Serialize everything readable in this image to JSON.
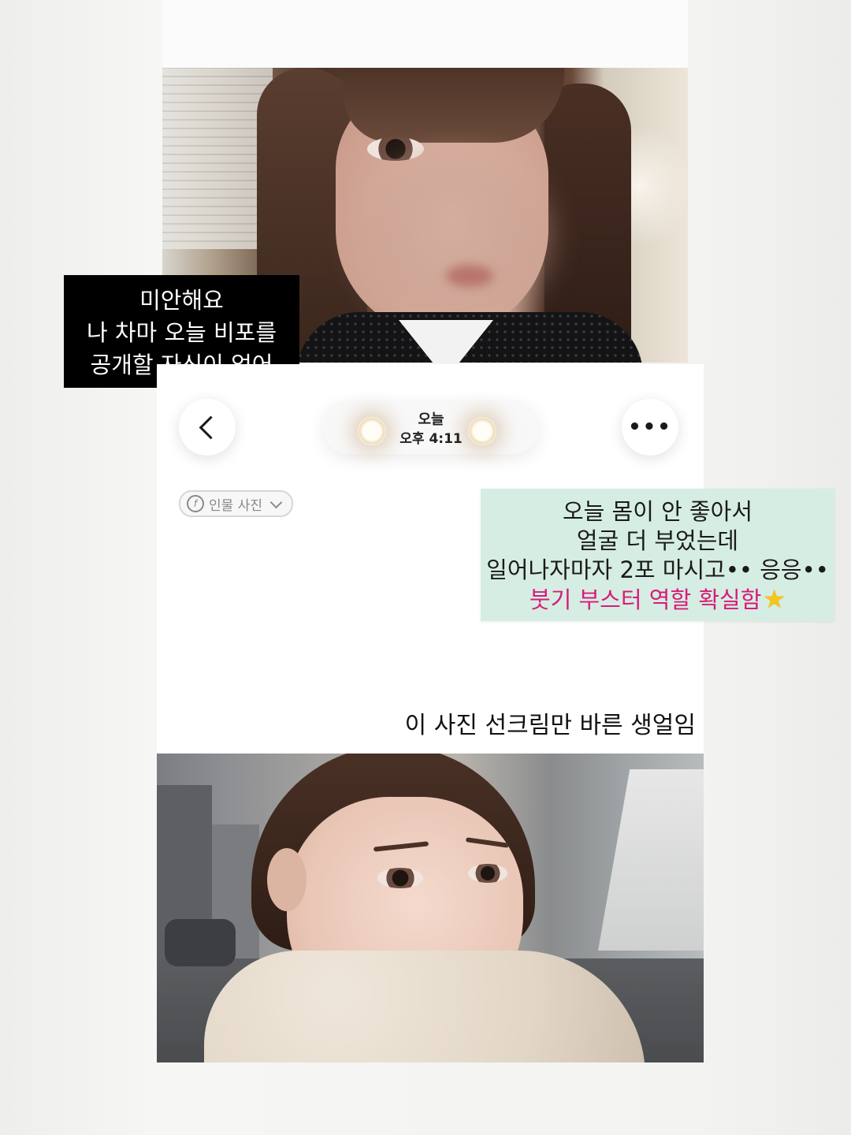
{
  "overlay_caption": {
    "lines": [
      "미안해요",
      "나 차마 오늘 비포를",
      "공개할 자신이 없어"
    ]
  },
  "chat_header": {
    "back_icon": "chevron-left-icon",
    "date_label": "오늘",
    "time_label": "오후 4:11",
    "more_icon": "more-horizontal-icon"
  },
  "people_tag": {
    "icon": "face-tag-icon",
    "label": "인물 사진"
  },
  "sticker": {
    "line1": "오늘 몸이 안 좋아서",
    "line2": "얼굴 더 부었는데",
    "line3": "일어나자마자 2포 마시고•• 응응••",
    "line4_highlight": "붓기 부스터 역할 확실함",
    "highlight_color": "#d81b7a",
    "background_color": "#d6ede3",
    "icon": "star-icon"
  },
  "bottom_caption": "이 사진 선크림만 바른 생얼임",
  "photos": {
    "top": "selfie-blurred-face",
    "bottom": "outdoor-selfie-face"
  }
}
